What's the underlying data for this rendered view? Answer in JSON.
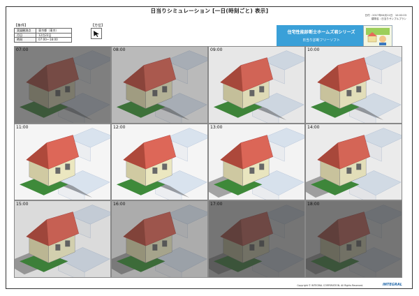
{
  "header": {
    "title": "日当りシミュレーション [一日(時刻ごと) 表示]",
    "date_line": "日付 : 2017年04月11日　10:02:03",
    "property_line": "建物名 : 日当りサンプルプラン"
  },
  "conditions": {
    "label": "【条件】",
    "rows": [
      {
        "key": "実展観測点",
        "value": "東京都（東京）"
      },
      {
        "key": "月日",
        "value": "12月22日"
      },
      {
        "key": "時刻",
        "value": "07:00～18:00"
      }
    ]
  },
  "direction": {
    "label": "【方位】",
    "icon": "north-arrow-icon"
  },
  "banner": {
    "line1": "住宅性能診断士ホームズ君シリーズ",
    "line2": "日当り診断フリーソフト"
  },
  "logo": {
    "icon": "homes-kun-logo-icon"
  },
  "frames": [
    {
      "time": "07:00",
      "shade": 0.65
    },
    {
      "time": "08:00",
      "shade": 0.35
    },
    {
      "time": "09:00",
      "shade": 0.12
    },
    {
      "time": "10:00",
      "shade": 0.1
    },
    {
      "time": "11:00",
      "shade": 0.05
    },
    {
      "time": "12:00",
      "shade": 0.05
    },
    {
      "time": "13:00",
      "shade": 0.06
    },
    {
      "time": "14:00",
      "shade": 0.1
    },
    {
      "time": "15:00",
      "shade": 0.18
    },
    {
      "time": "16:00",
      "shade": 0.42
    },
    {
      "time": "17:00",
      "shade": 0.7
    },
    {
      "time": "18:00",
      "shade": 0.7
    }
  ],
  "footer": {
    "copyright": "Copyright © INTEGRAL CORPORATION. All Rights Reserved.",
    "brand": "INTEGRAL"
  },
  "colors": {
    "banner": "#3aa0d8",
    "roof": "#e66a5a",
    "wall": "#f5f1c8",
    "lawn": "#3f8f3a",
    "neighbor": "#e2ecf8"
  }
}
